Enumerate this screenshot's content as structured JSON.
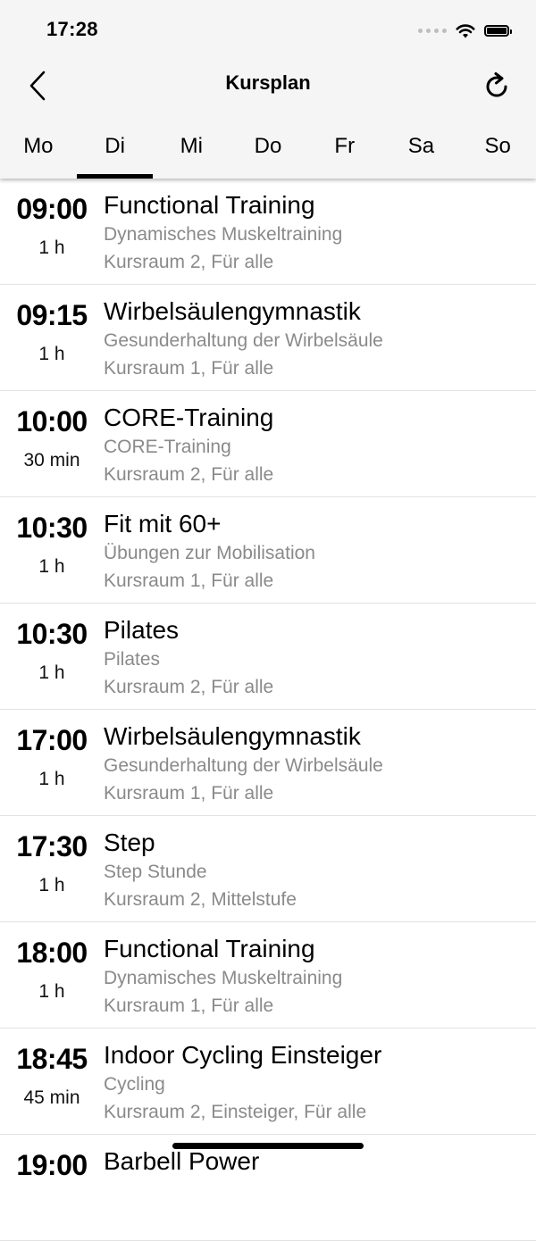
{
  "status_bar": {
    "time": "17:28"
  },
  "nav": {
    "title": "Kursplan",
    "back_icon": "chevron-left-icon",
    "refresh_icon": "refresh-icon"
  },
  "days": [
    "Mo",
    "Di",
    "Mi",
    "Do",
    "Fr",
    "Sa",
    "So"
  ],
  "active_day": "Di",
  "courses": [
    {
      "time": "09:00",
      "duration": "1 h",
      "name": "Functional Training",
      "description": "Dynamisches Muskeltraining",
      "details": "Kursraum 2, Für alle"
    },
    {
      "time": "09:15",
      "duration": "1 h",
      "name": "Wirbelsäulengymnastik",
      "description": "Gesunderhaltung der Wirbelsäule",
      "details": "Kursraum 1, Für alle"
    },
    {
      "time": "10:00",
      "duration": "30 min",
      "name": "CORE-Training",
      "description": "CORE-Training",
      "details": "Kursraum 2, Für alle"
    },
    {
      "time": "10:30",
      "duration": "1 h",
      "name": "Fit mit 60+",
      "description": "Übungen zur Mobilisation",
      "details": "Kursraum 1, Für alle"
    },
    {
      "time": "10:30",
      "duration": "1 h",
      "name": "Pilates",
      "description": "Pilates",
      "details": "Kursraum 2, Für alle"
    },
    {
      "time": "17:00",
      "duration": "1 h",
      "name": "Wirbelsäulengymnastik",
      "description": "Gesunderhaltung der Wirbelsäule",
      "details": "Kursraum 1, Für alle"
    },
    {
      "time": "17:30",
      "duration": "1 h",
      "name": "Step",
      "description": "Step Stunde",
      "details": "Kursraum 2, Mittelstufe"
    },
    {
      "time": "18:00",
      "duration": "1 h",
      "name": "Functional Training",
      "description": "Dynamisches Muskeltraining",
      "details": "Kursraum 1, Für alle"
    },
    {
      "time": "18:45",
      "duration": "45 min",
      "name": "Indoor Cycling Einsteiger",
      "description": "Cycling",
      "details": "Kursraum 2, Einsteiger, Für alle"
    },
    {
      "time": "19:00",
      "duration": "",
      "name": "Barbell Power",
      "description": "",
      "details": ""
    }
  ]
}
